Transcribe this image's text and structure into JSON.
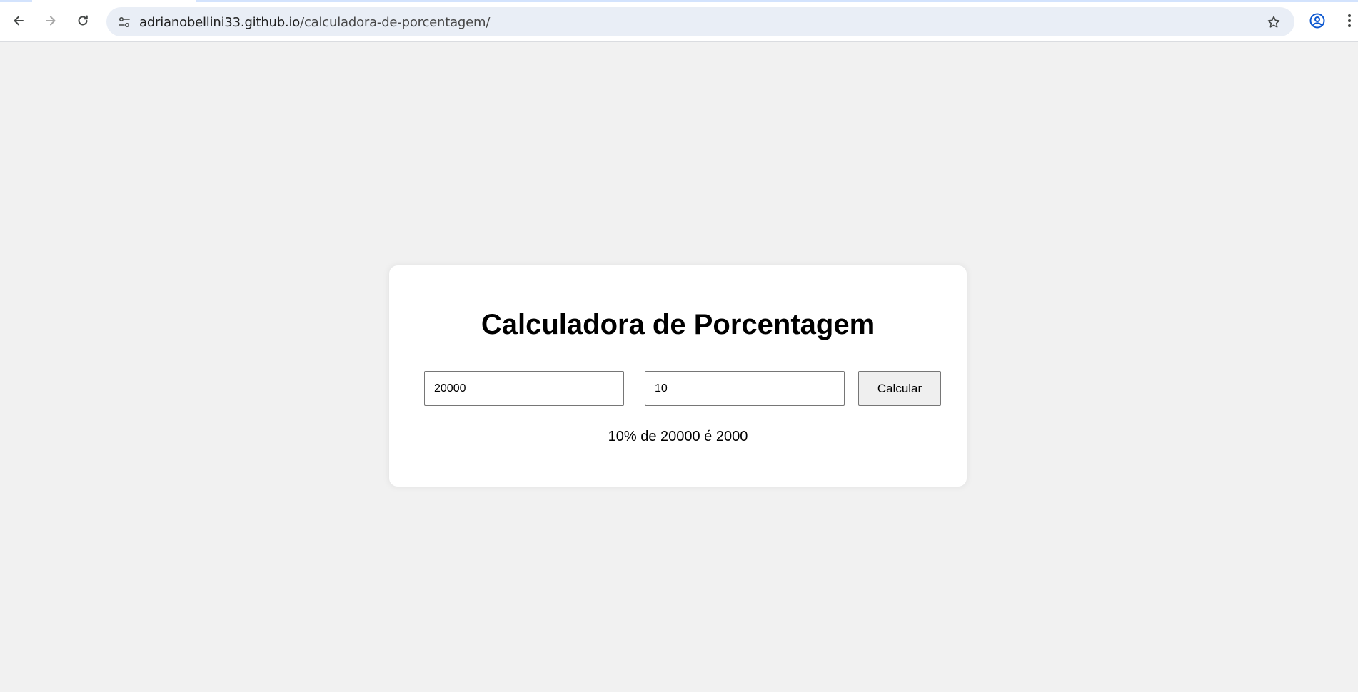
{
  "browser": {
    "url_host": "adrianobellini33.github.io",
    "url_path": "/calculadora-de-porcentagem/",
    "icons": {
      "back": "back-arrow-icon",
      "forward": "forward-arrow-icon",
      "reload": "reload-icon",
      "site_info": "site-info-icon",
      "bookmark": "star-icon",
      "profile": "profile-icon",
      "menu": "kebab-menu-icon"
    }
  },
  "page": {
    "title": "Calculadora de Porcentagem",
    "value_input": {
      "value": "20000"
    },
    "percent_input": {
      "value": "10"
    },
    "calculate_label": "Calcular",
    "result_text": "10% de 20000 é 2000"
  },
  "colors": {
    "page_background": "#f1f1f1",
    "card_background": "#ffffff",
    "omnibox_background": "#e9eef6",
    "profile_icon": "#0b57d0"
  }
}
